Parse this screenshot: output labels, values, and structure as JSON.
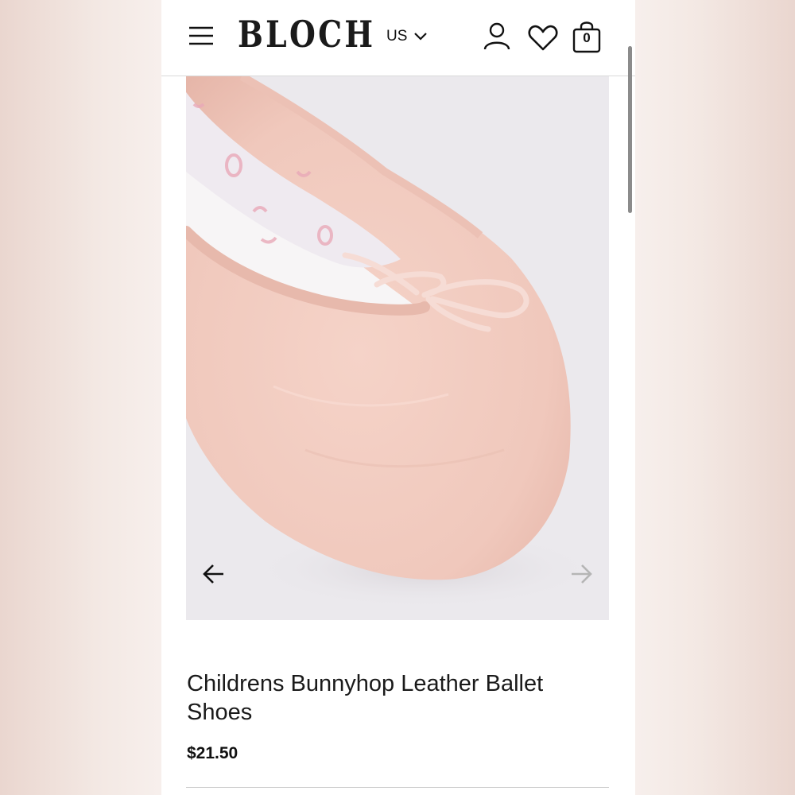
{
  "header": {
    "logo": "BLOCH",
    "region": "US",
    "cart_count": "0"
  },
  "product": {
    "title": "Childrens Bunnyhop Leather Ballet Shoes",
    "price": "$21.50"
  },
  "colors": {
    "shoe": "#f2cbc0",
    "gallery_background": "#ebe9ed",
    "arrow_disabled": "#b5b5b5"
  }
}
